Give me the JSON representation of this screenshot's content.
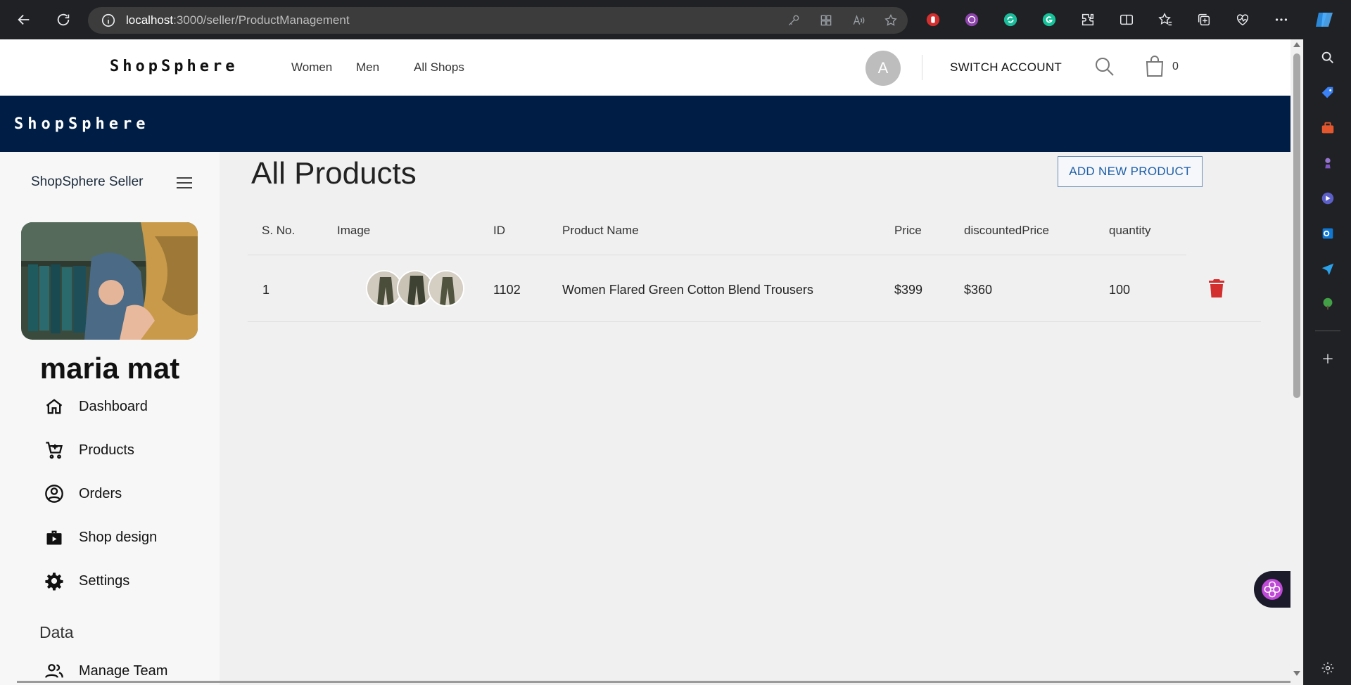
{
  "browser": {
    "url_host": "localhost",
    "url_path": ":3000/seller/ProductManagement"
  },
  "site_nav": {
    "brand": "ShopSphere",
    "links": [
      "Women",
      "Men",
      "All Shops"
    ],
    "avatar_initial": "A",
    "switch_account": "SWITCH ACCOUNT",
    "cart_count": "0"
  },
  "banner": {
    "brand": "ShopSphere"
  },
  "sidebar": {
    "title": "ShopSphere Seller",
    "seller_name": "maria mat",
    "items": [
      {
        "label": "Dashboard",
        "icon": "home-icon"
      },
      {
        "label": "Products",
        "icon": "cart-icon"
      },
      {
        "label": "Orders",
        "icon": "account-circle-icon"
      },
      {
        "label": "Shop design",
        "icon": "shop-bag-icon"
      },
      {
        "label": "Settings",
        "icon": "gear-icon"
      }
    ],
    "data_heading": "Data",
    "data_items": [
      {
        "label": "Manage Team",
        "icon": "people-icon"
      }
    ]
  },
  "main": {
    "title": "All Products",
    "add_button": "ADD NEW PRODUCT",
    "columns": [
      "S. No.",
      "Image",
      "ID",
      "Product Name",
      "Price",
      "discountedPrice",
      "quantity"
    ],
    "rows": [
      {
        "sno": "1",
        "id": "1102",
        "name": "Women Flared Green Cotton Blend Trousers",
        "price": "$399",
        "discounted_price": "$360",
        "quantity": "100"
      }
    ]
  },
  "colors": {
    "banner": "#001e45",
    "accent_button": "#1e5fa8",
    "delete": "#d32f2f"
  }
}
